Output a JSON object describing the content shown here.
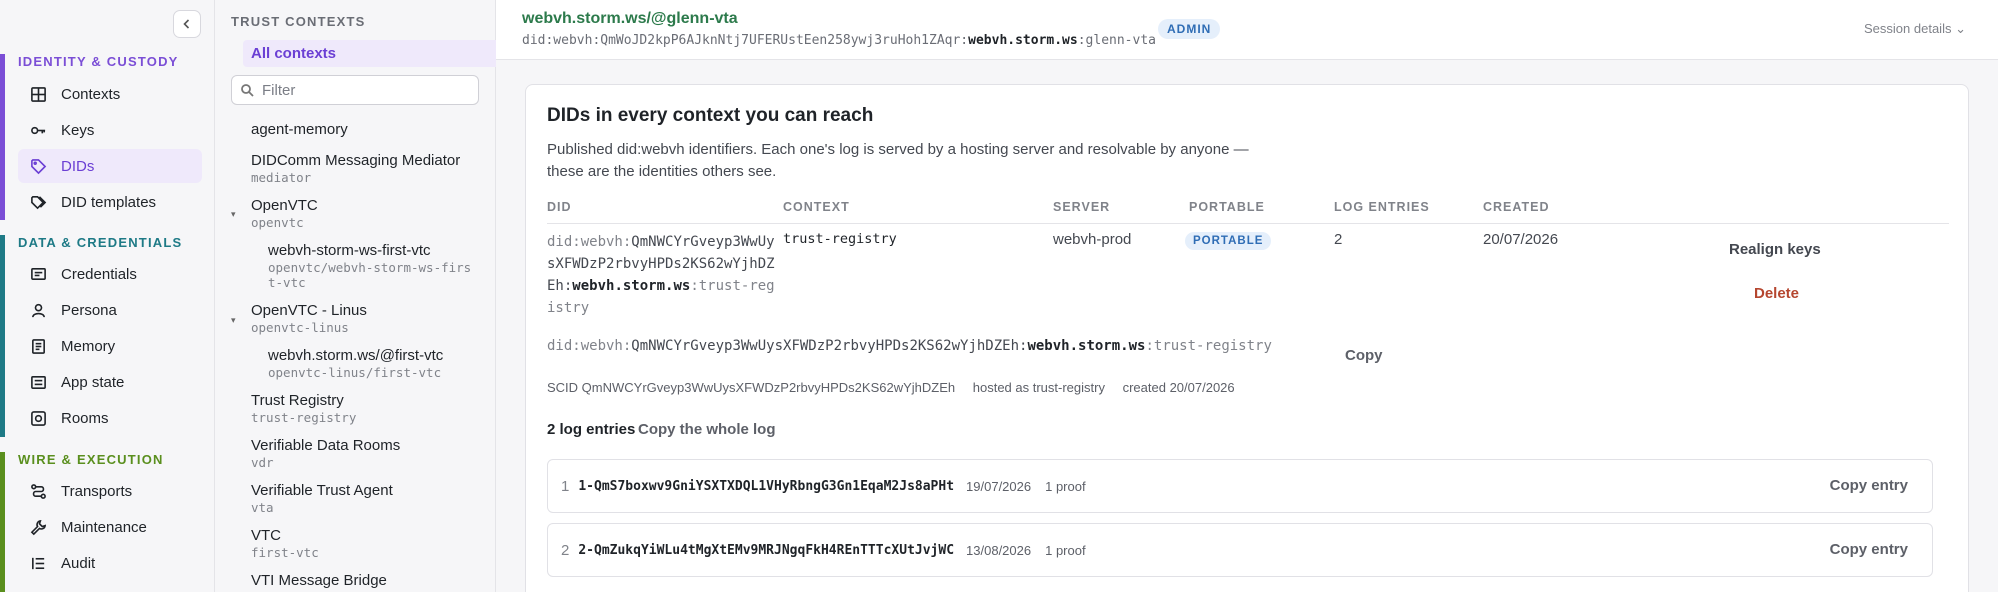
{
  "nav": {
    "groups": [
      {
        "title": "IDENTITY & CUSTODY",
        "color": "#7b4ed6",
        "items": [
          {
            "label": "Contexts",
            "icon": "grid-icon"
          },
          {
            "label": "Keys",
            "icon": "key-icon"
          },
          {
            "label": "DIDs",
            "icon": "tag-icon",
            "active": true
          },
          {
            "label": "DID templates",
            "icon": "tags-icon"
          }
        ]
      },
      {
        "title": "DATA & CREDENTIALS",
        "color": "#1e7a86",
        "items": [
          {
            "label": "Credentials",
            "icon": "credential-icon"
          },
          {
            "label": "Persona",
            "icon": "person-icon"
          },
          {
            "label": "Memory",
            "icon": "document-icon"
          },
          {
            "label": "App state",
            "icon": "app-state-icon"
          },
          {
            "label": "Rooms",
            "icon": "rooms-icon"
          }
        ]
      },
      {
        "title": "WIRE & EXECUTION",
        "color": "#5a8f1e",
        "items": [
          {
            "label": "Transports",
            "icon": "route-icon"
          },
          {
            "label": "Maintenance",
            "icon": "wrench-icon"
          },
          {
            "label": "Audit",
            "icon": "list-icon"
          }
        ]
      }
    ]
  },
  "contexts": {
    "title": "TRUST CONTEXTS",
    "all_label": "All contexts",
    "filter_placeholder": "Filter",
    "items": [
      {
        "name": "agent-memory",
        "sub": ""
      },
      {
        "name": "DIDComm Messaging Mediator",
        "sub": "mediator"
      },
      {
        "name": "OpenVTC",
        "sub": "openvtc",
        "expanded": true
      },
      {
        "name": "webvh-storm-ws-first-vtc",
        "sub": "openvtc/webvh-storm-ws-first-vtc",
        "child": true
      },
      {
        "name": "OpenVTC - Linus",
        "sub": "openvtc-linus",
        "expanded": true
      },
      {
        "name": "webvh.storm.ws/@first-vtc",
        "sub": "openvtc-linus/first-vtc",
        "child": true
      },
      {
        "name": "Trust Registry",
        "sub": "trust-registry"
      },
      {
        "name": "Verifiable Data Rooms",
        "sub": "vdr"
      },
      {
        "name": "Verifiable Trust Agent",
        "sub": "vta"
      },
      {
        "name": "VTC",
        "sub": "first-vtc"
      },
      {
        "name": "VTI Message Bridge",
        "sub": ""
      }
    ]
  },
  "header": {
    "title": "webvh.storm.ws/@glenn-vta",
    "did_prefix": "did:webvh:",
    "did_scid": "QmWoJD2kpP6AJknNtj7UFERUstEen258ywj3ruHoh1ZAqr:",
    "did_host": "webvh.storm.ws",
    "did_path": ":glenn-vta",
    "badge": "ADMIN",
    "session_label": "Session details"
  },
  "card": {
    "title": "DIDs in every context you can reach",
    "description": "Published did:webvh identifiers. Each one's log is served by a hosting server and resolvable by anyone — these are the identities others see.",
    "columns": [
      "DID",
      "CONTEXT",
      "SERVER",
      "PORTABLE",
      "LOG ENTRIES",
      "CREATED"
    ],
    "row": {
      "did_prefix": "did:webvh:",
      "did_scid": "QmNWCYrGveyp3WwUysXFWDzP2rbvyHPDs2KS62wYjhDZEh:",
      "did_host": "webvh.storm.ws",
      "did_path": ":trust-registry",
      "context": "trust-registry",
      "server": "webvh-prod",
      "portable": "PORTABLE",
      "log_entries": "2",
      "created": "20/07/2026",
      "realign_label": "Realign keys",
      "delete_label": "Delete",
      "copy_label": "Copy",
      "scid_text": "SCID QmNWCYrGveyp3WwUysXFWDzP2rbvyHPDs2KS62wYjhDZEh",
      "hosted_text": "hosted as trust-registry",
      "created_text": "created 20/07/2026"
    },
    "log": {
      "heading": "2 log entries",
      "copy_all_label": "Copy the whole log",
      "entries": [
        {
          "index": "1",
          "hash": "1-QmS7boxwv9GniYSXTXDQL1VHyRbngG3Gn1EqaM2Js8aPHt",
          "date": "19/07/2026",
          "proofs": "1 proof",
          "copy_label": "Copy entry"
        },
        {
          "index": "2",
          "hash": "2-QmZukqYiWLu4tMgXtEMv9MRJNgqFkH4REnTTTcXUtJvjWC",
          "date": "13/08/2026",
          "proofs": "1 proof",
          "copy_label": "Copy entry"
        }
      ]
    }
  },
  "colors": {
    "accent": "#6b3fd4",
    "green": "#2c7a4b",
    "badge_blue": "#2f6db5",
    "delete_red": "#b5462f"
  }
}
